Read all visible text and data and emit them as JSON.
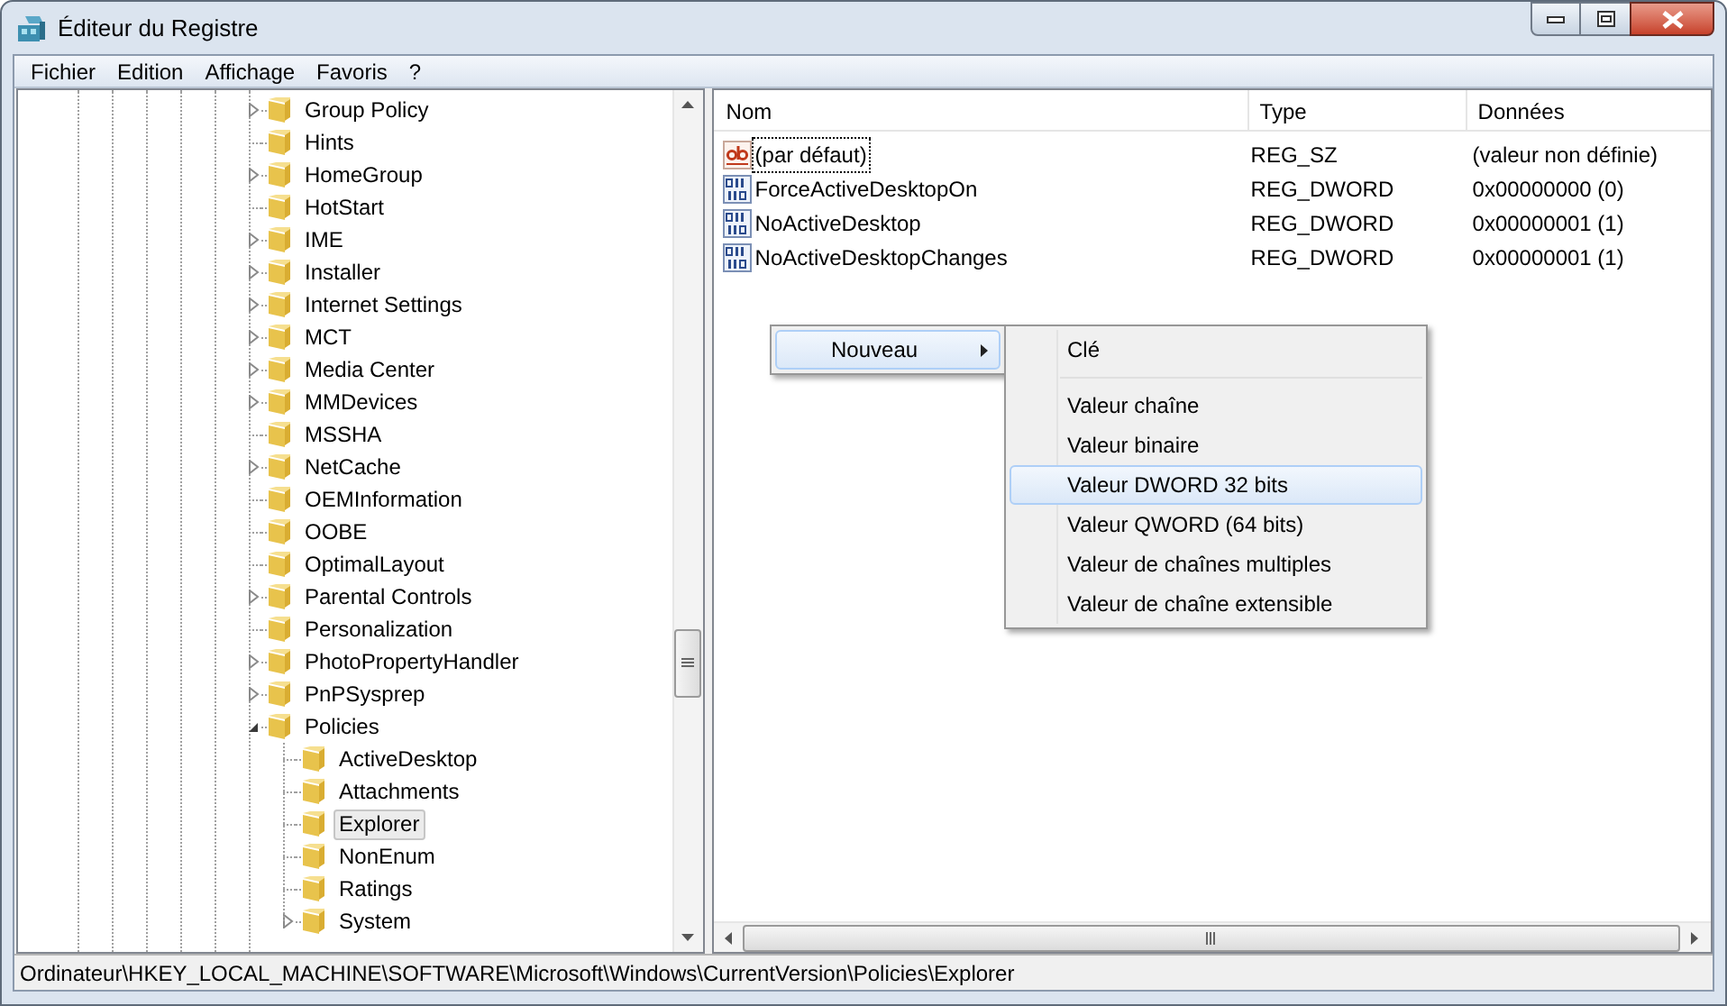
{
  "window": {
    "title": "Éditeur du Registre"
  },
  "menu_bar": [
    {
      "label": "Fichier"
    },
    {
      "label": "Edition"
    },
    {
      "label": "Affichage"
    },
    {
      "label": "Favoris"
    },
    {
      "label": "?"
    }
  ],
  "tree": {
    "items": [
      {
        "label": "Group Policy",
        "expandable": true,
        "expanded": false,
        "selected": false
      },
      {
        "label": "Hints",
        "expandable": false,
        "selected": false
      },
      {
        "label": "HomeGroup",
        "expandable": true,
        "expanded": false,
        "selected": false
      },
      {
        "label": "HotStart",
        "expandable": false,
        "selected": false
      },
      {
        "label": "IME",
        "expandable": true,
        "expanded": false,
        "selected": false
      },
      {
        "label": "Installer",
        "expandable": true,
        "expanded": false,
        "selected": false
      },
      {
        "label": "Internet Settings",
        "expandable": true,
        "expanded": false,
        "selected": false
      },
      {
        "label": "MCT",
        "expandable": true,
        "expanded": false,
        "selected": false
      },
      {
        "label": "Media Center",
        "expandable": true,
        "expanded": false,
        "selected": false
      },
      {
        "label": "MMDevices",
        "expandable": true,
        "expanded": false,
        "selected": false
      },
      {
        "label": "MSSHA",
        "expandable": false,
        "selected": false
      },
      {
        "label": "NetCache",
        "expandable": true,
        "expanded": false,
        "selected": false
      },
      {
        "label": "OEMInformation",
        "expandable": false,
        "selected": false
      },
      {
        "label": "OOBE",
        "expandable": false,
        "selected": false
      },
      {
        "label": "OptimalLayout",
        "expandable": false,
        "selected": false
      },
      {
        "label": "Parental Controls",
        "expandable": true,
        "expanded": false,
        "selected": false
      },
      {
        "label": "Personalization",
        "expandable": false,
        "selected": false
      },
      {
        "label": "PhotoPropertyHandler",
        "expandable": true,
        "expanded": false,
        "selected": false
      },
      {
        "label": "PnPSysprep",
        "expandable": true,
        "expanded": false,
        "selected": false
      },
      {
        "label": "Policies",
        "expandable": true,
        "expanded": true,
        "selected": false,
        "children": [
          {
            "label": "ActiveDesktop",
            "expandable": false,
            "selected": false
          },
          {
            "label": "Attachments",
            "expandable": false,
            "selected": false
          },
          {
            "label": "Explorer",
            "expandable": false,
            "selected": true
          },
          {
            "label": "NonEnum",
            "expandable": false,
            "selected": false
          },
          {
            "label": "Ratings",
            "expandable": false,
            "selected": false
          },
          {
            "label": "System",
            "expandable": true,
            "expanded": false,
            "selected": false
          }
        ]
      }
    ]
  },
  "values_list": {
    "columns": [
      "Nom",
      "Type",
      "Données"
    ],
    "rows": [
      {
        "kind": "string",
        "name": "(par défaut)",
        "type": "REG_SZ",
        "data": "(valeur non définie)",
        "focused": true
      },
      {
        "kind": "dword",
        "name": "ForceActiveDesktopOn",
        "type": "REG_DWORD",
        "data": "0x00000000 (0)",
        "focused": false
      },
      {
        "kind": "dword",
        "name": "NoActiveDesktop",
        "type": "REG_DWORD",
        "data": "0x00000001 (1)",
        "focused": false
      },
      {
        "kind": "dword",
        "name": "NoActiveDesktopChanges",
        "type": "REG_DWORD",
        "data": "0x00000001 (1)",
        "focused": false
      }
    ]
  },
  "context_menu": {
    "items": [
      {
        "label": "Nouveau",
        "has_submenu": true,
        "selected": true
      }
    ]
  },
  "submenu": {
    "items": [
      {
        "kind": "item",
        "label": "Clé",
        "selected": false
      },
      {
        "kind": "separator"
      },
      {
        "kind": "item",
        "label": "Valeur chaîne",
        "selected": false
      },
      {
        "kind": "item",
        "label": "Valeur binaire",
        "selected": false
      },
      {
        "kind": "item",
        "label": "Valeur DWORD 32 bits",
        "selected": true
      },
      {
        "kind": "item",
        "label": "Valeur QWORD (64 bits)",
        "selected": false
      },
      {
        "kind": "item",
        "label": "Valeur de chaînes multiples",
        "selected": false
      },
      {
        "kind": "item",
        "label": "Valeur de chaîne extensible",
        "selected": false
      }
    ]
  },
  "status_bar": "Ordinateur\\HKEY_LOCAL_MACHINE\\SOFTWARE\\Microsoft\\Windows\\CurrentVersion\\Policies\\Explorer"
}
